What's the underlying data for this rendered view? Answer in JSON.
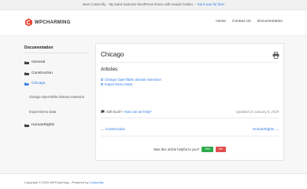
{
  "topbar": {
    "text": "Meet Customify – My latest business WordPress theme with Header builder. – ",
    "link": "Get it now for free!"
  },
  "brand": {
    "name": "WPCHARMING",
    "accent": "#e8412c"
  },
  "nav": {
    "items": [
      "Home",
      "Contact Us",
      "Documentation"
    ]
  },
  "sidebar": {
    "title": "Documentation",
    "items": [
      {
        "label": "General"
      },
      {
        "label": "Construction"
      },
      {
        "label": "Chicago"
      },
      {
        "label": "HumanRights"
      }
    ],
    "sub_items": [
      "Change OpenTable domain extension",
      "Import Demo Data"
    ]
  },
  "article": {
    "title": "Chicago",
    "section_heading": "Articles",
    "links": [
      "Change OpenTable domain extension",
      "Import Demo Data"
    ],
    "stuck_text": "Still stuck?",
    "stuck_link": "How can we help?",
    "updated": "Updated on January 8, 2019",
    "prev": "← Construction",
    "next": "HumanRights →",
    "helpful_question": "Was this article helpful to you?",
    "yes_label": "Yes",
    "no_label": "No"
  },
  "footer": {
    "text": "Copyright © 2020 WPCharming – Powered by ",
    "link": "Customify"
  },
  "colors": {
    "link": "#2c7be5",
    "yes": "#2eaa4b",
    "no": "#e04d4d"
  }
}
